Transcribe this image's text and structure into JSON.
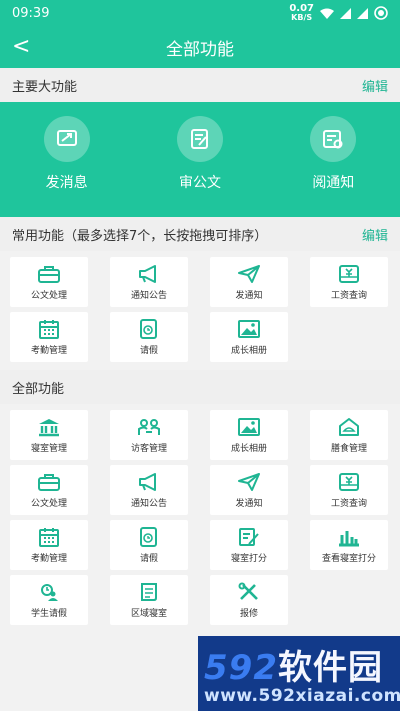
{
  "status_bar": {
    "time": "09:39",
    "net_speed_value": "0.07",
    "net_speed_unit": "KB/S"
  },
  "title_bar": {
    "back": "<",
    "title": "全部功能"
  },
  "main_section": {
    "title": "主要大功能",
    "edit": "编辑",
    "items": [
      {
        "label": "发消息",
        "icon": "message-send-icon"
      },
      {
        "label": "审公文",
        "icon": "document-review-icon"
      },
      {
        "label": "阅通知",
        "icon": "notice-read-icon"
      }
    ]
  },
  "common_section": {
    "title": "常用功能（最多选择7个，长按拖拽可排序）",
    "edit": "编辑",
    "items": [
      {
        "label": "公文处理",
        "icon": "briefcase-icon"
      },
      {
        "label": "通知公告",
        "icon": "megaphone-icon"
      },
      {
        "label": "发通知",
        "icon": "paper-plane-icon"
      },
      {
        "label": "工资查询",
        "icon": "salary-icon"
      },
      {
        "label": "考勤管理",
        "icon": "calendar-icon"
      },
      {
        "label": "请假",
        "icon": "leave-icon"
      },
      {
        "label": "成长相册",
        "icon": "photo-album-icon"
      }
    ]
  },
  "all_section": {
    "title": "全部功能",
    "items": [
      {
        "label": "寝室管理",
        "icon": "building-icon"
      },
      {
        "label": "访客管理",
        "icon": "visitors-icon"
      },
      {
        "label": "成长相册",
        "icon": "photo-album-icon"
      },
      {
        "label": "膳食管理",
        "icon": "meal-icon"
      },
      {
        "label": "公文处理",
        "icon": "briefcase-icon"
      },
      {
        "label": "通知公告",
        "icon": "megaphone-icon"
      },
      {
        "label": "发通知",
        "icon": "paper-plane-icon"
      },
      {
        "label": "工资查询",
        "icon": "salary-icon"
      },
      {
        "label": "考勤管理",
        "icon": "calendar-icon"
      },
      {
        "label": "请假",
        "icon": "leave-icon"
      },
      {
        "label": "寝室打分",
        "icon": "score-edit-icon"
      },
      {
        "label": "查看寝室打分",
        "icon": "bar-chart-icon"
      },
      {
        "label": "学生请假",
        "icon": "student-leave-icon"
      },
      {
        "label": "区域寝室",
        "icon": "area-room-icon"
      },
      {
        "label": "报修",
        "icon": "repair-tools-icon"
      }
    ]
  },
  "watermark": {
    "brand_num": "592",
    "brand_cn": "软件园",
    "url": "www.592xiazai.com"
  },
  "colors": {
    "accent": "#1fc59c",
    "edit_text": "#1fb593",
    "icon": "#1fb593"
  }
}
